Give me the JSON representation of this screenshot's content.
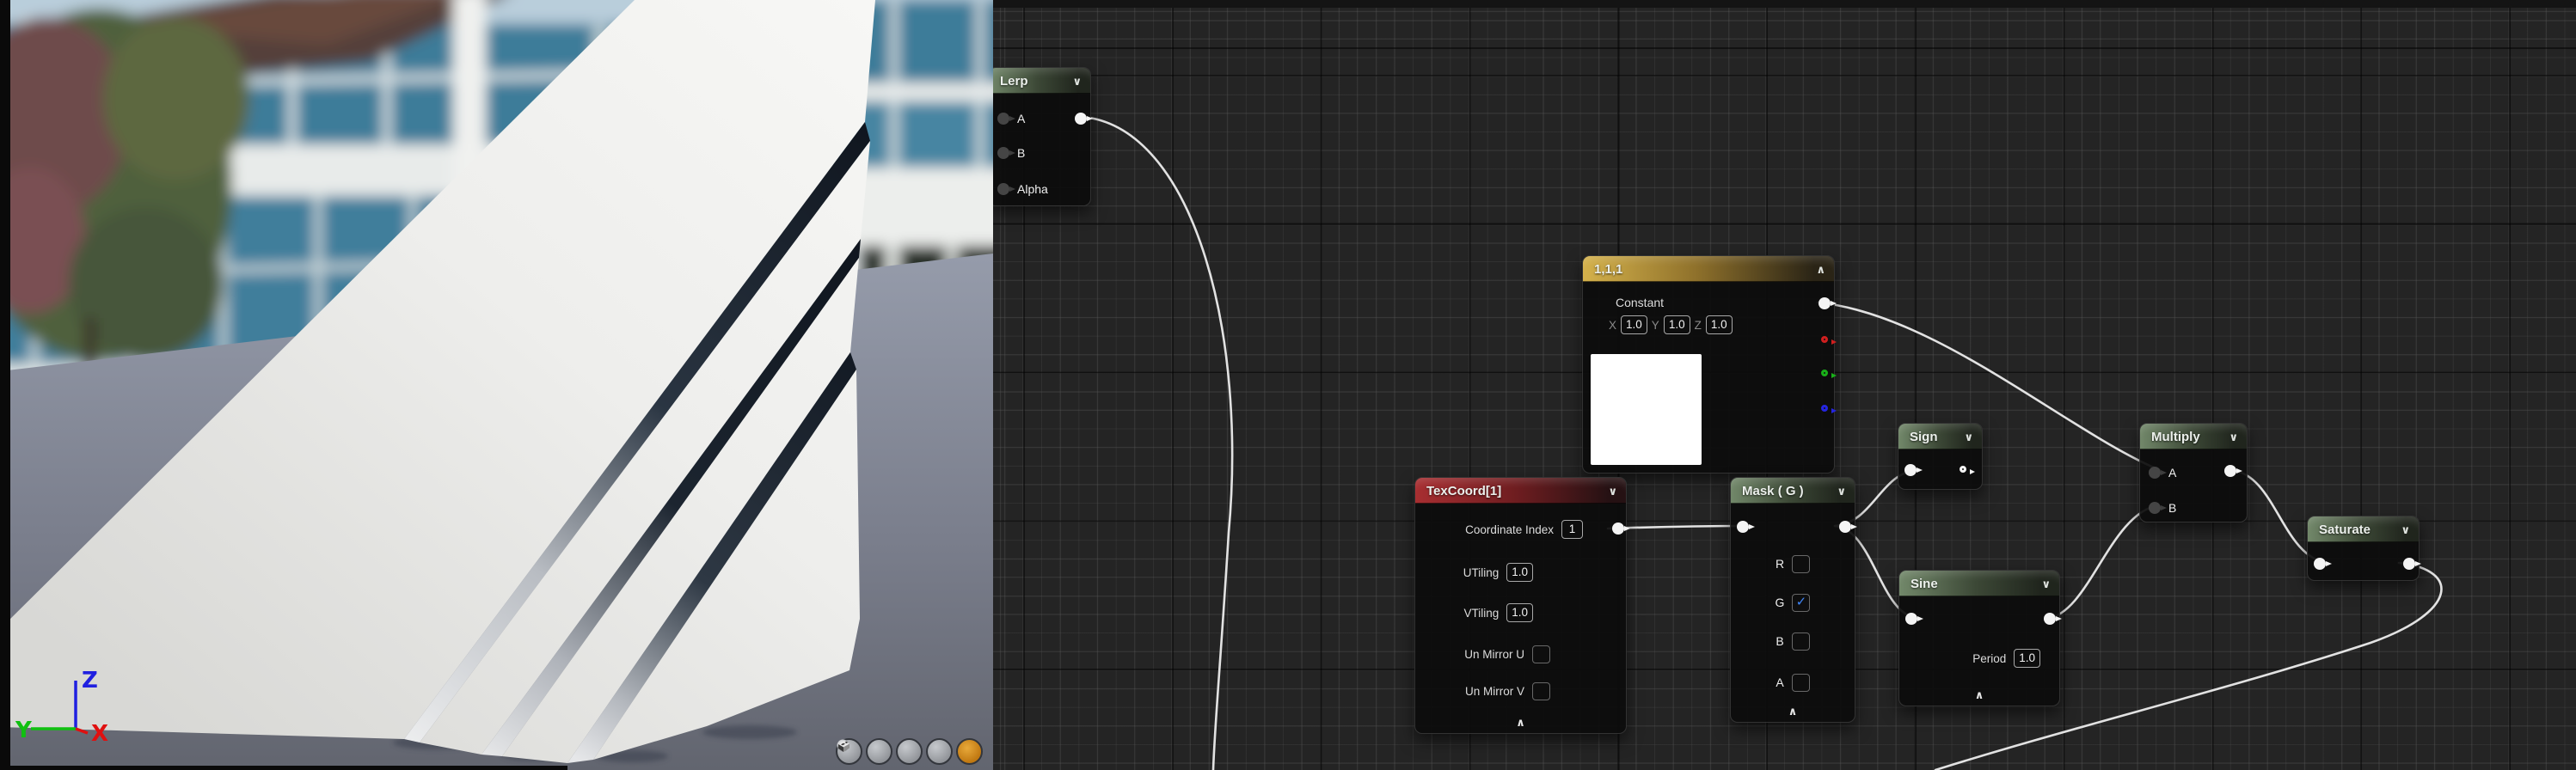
{
  "viewport": {
    "description": "3D material preview: white slatted fin mesh on gray floor, blurred office building backdrop",
    "axis": {
      "x": "X",
      "y": "Y",
      "z": "Z"
    },
    "axis_colors": {
      "x": "#e01010",
      "y": "#10c010",
      "z": "#2020e0"
    },
    "preview_shapes": [
      {
        "name": "cylinder",
        "active": false
      },
      {
        "name": "sphere",
        "active": false
      },
      {
        "name": "plane",
        "active": false
      },
      {
        "name": "cube",
        "active": false
      },
      {
        "name": "mesh",
        "active": true
      }
    ]
  },
  "graph": {
    "nodes": {
      "lerp": {
        "title": "Lerp",
        "inputs": [
          "A",
          "B",
          "Alpha"
        ]
      },
      "constant": {
        "title": "1,1,1",
        "subtitle": "Constant",
        "fields": [
          {
            "label": "X",
            "value": "1.0"
          },
          {
            "label": "Y",
            "value": "1.0"
          },
          {
            "label": "Z",
            "value": "1.0"
          }
        ]
      },
      "texcoord": {
        "title": "TexCoord[1]",
        "fields": [
          {
            "label": "Coordinate Index",
            "value": "1"
          },
          {
            "label": "UTiling",
            "value": "1.0"
          },
          {
            "label": "VTiling",
            "value": "1.0"
          }
        ],
        "checkboxes": [
          {
            "label": "Un Mirror U",
            "mark": ""
          },
          {
            "label": "Un Mirror V",
            "mark": ""
          }
        ]
      },
      "mask": {
        "title": "Mask ( G )",
        "checkboxes": [
          {
            "label": "R",
            "mark": ""
          },
          {
            "label": "G",
            "mark": "✓"
          },
          {
            "label": "B",
            "mark": ""
          },
          {
            "label": "A",
            "mark": ""
          }
        ]
      },
      "sign": {
        "title": "Sign"
      },
      "sine": {
        "title": "Sine",
        "fields": [
          {
            "label": "Period",
            "value": "1.0"
          }
        ]
      },
      "multiply": {
        "title": "Multiply",
        "inputs": [
          "A",
          "B"
        ]
      },
      "saturate": {
        "title": "Saturate"
      }
    },
    "connections": [
      {
        "from": "Lerp (A output)",
        "to": "offscreen bottom"
      },
      {
        "from": "TexCoord[1]",
        "to": "Mask ( G )"
      },
      {
        "from": "Mask ( G )",
        "to": "Sign"
      },
      {
        "from": "Mask ( G )",
        "to": "Sine"
      },
      {
        "from": "1,1,1 Constant",
        "to": "Multiply A"
      },
      {
        "from": "Sine",
        "to": "Multiply B"
      },
      {
        "from": "Multiply A*B",
        "to": "Saturate"
      },
      {
        "from": "Saturate",
        "to": "offscreen bottom"
      }
    ],
    "colors": {
      "header_green": "#5c7252",
      "header_gold": "#c9a53e",
      "header_red": "#9e2a2e",
      "checkbox_blue": "#3f86f8",
      "pin_red": "#d01f1f",
      "pin_green": "#19b019",
      "pin_blue": "#2525e0",
      "wire": "#e2e2e2",
      "grid_bg": "#242424",
      "mesh_button_orange": "#cf8a1f"
    }
  }
}
